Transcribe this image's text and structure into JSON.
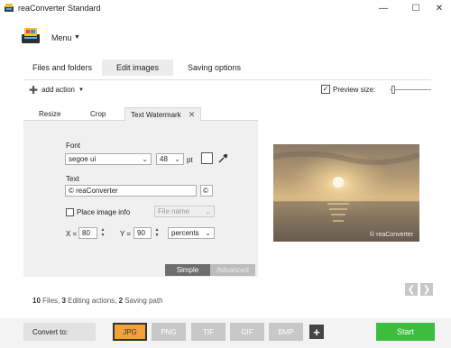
{
  "window": {
    "title": "reaConverter Standard",
    "controls": {
      "minimize": "—",
      "maximize": "☐",
      "close": "✕"
    }
  },
  "menu": {
    "label": "Menu"
  },
  "tabs": [
    {
      "label": "Files and folders"
    },
    {
      "label": "Edit images",
      "active": true
    },
    {
      "label": "Saving options"
    }
  ],
  "toolbar": {
    "add_action_label": "add action",
    "preview_label": "Preview size:",
    "preview_checked": true,
    "preview_size_level": 0.05
  },
  "subtabs": [
    {
      "label": "Resize"
    },
    {
      "label": "Crop"
    },
    {
      "label": "Text Watermark",
      "active": true
    }
  ],
  "watermark": {
    "font_label": "Font",
    "font_value": "segoe ui",
    "size_value": "48",
    "size_unit": "pt",
    "text_label": "Text",
    "text_value": "© reaConverter",
    "copyright_btn": "©",
    "place_info_label": "Place image info",
    "place_info_checked": false,
    "info_select": "File name",
    "x_label": "X =",
    "x_value": "80",
    "y_label": "Y =",
    "y_value": "90",
    "units": "percents",
    "mode_simple": "Simple",
    "mode_advanced": "Advanced"
  },
  "preview": {
    "watermark_text": "© reaConverter"
  },
  "status": {
    "files_count": "10",
    "files_label": " Files, ",
    "actions_count": "3",
    "actions_label": " Editing actions, ",
    "paths_count": "2",
    "paths_label": " Saving path"
  },
  "bottom": {
    "convert_to": "Convert to:",
    "formats": [
      "JPG",
      "PNG",
      "TIF",
      "GIF",
      "BMP"
    ],
    "selected_format": "JPG",
    "start": "Start"
  },
  "colors": {
    "accent_green": "#3dbd3d",
    "selected_format": "#f3a23a"
  }
}
